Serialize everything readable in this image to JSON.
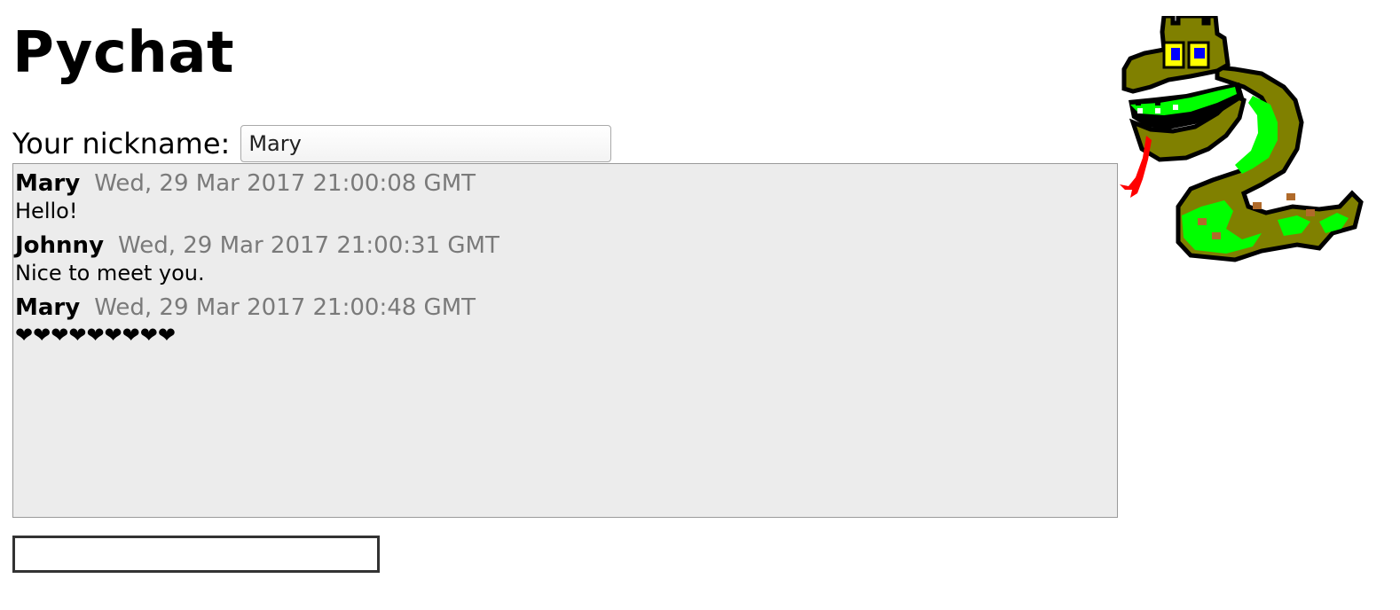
{
  "app": {
    "title": "Pychat"
  },
  "nickname": {
    "label": "Your nickname:",
    "value": "Mary"
  },
  "messages": [
    {
      "author": "Mary",
      "time": "Wed, 29 Mar 2017 21:00:08 GMT",
      "text": "Hello!"
    },
    {
      "author": "Johnny",
      "time": "Wed, 29 Mar 2017 21:00:31 GMT",
      "text": "Nice to meet you."
    },
    {
      "author": "Mary",
      "time": "Wed, 29 Mar 2017 21:00:48 GMT",
      "text": "❤❤❤❤❤❤❤❤❤"
    }
  ],
  "compose": {
    "value": ""
  },
  "colors": {
    "messages_background": "#ececec",
    "timestamp": "#7a7a7a",
    "snake_body": "#808000",
    "snake_belly": "#00ff00",
    "snake_tongue": "#ff0000",
    "snake_eyes": "#ffff00",
    "snake_pupils": "#0000ff"
  },
  "icons": {
    "mascot": "python-snake-icon"
  }
}
